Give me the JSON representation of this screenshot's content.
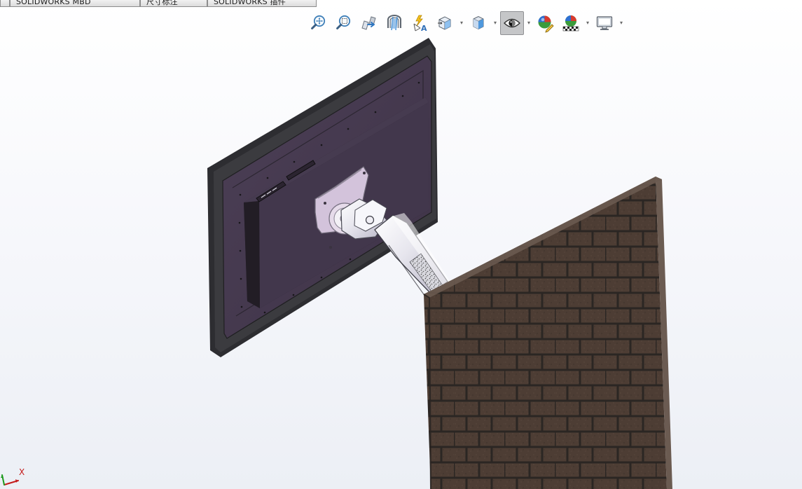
{
  "tabs": [
    {
      "label": ""
    },
    {
      "label": "SOLIDWORKS MBD"
    },
    {
      "label": "尺寸标注"
    },
    {
      "label": "SOLIDWORKS 插件"
    }
  ],
  "toolbar": {
    "items": [
      {
        "name": "zoom-to-fit",
        "icon": "zoom-fit-icon",
        "has_dropdown": false,
        "active": false
      },
      {
        "name": "zoom-to-area",
        "icon": "zoom-area-icon",
        "has_dropdown": false,
        "active": false
      },
      {
        "name": "previous-view",
        "icon": "previous-view-icon",
        "has_dropdown": false,
        "active": false
      },
      {
        "name": "section-view",
        "icon": "section-view-icon",
        "has_dropdown": false,
        "active": false
      },
      {
        "name": "dynamic-annotation-views",
        "icon": "dynamic-annotation-icon",
        "has_dropdown": false,
        "active": false
      },
      {
        "name": "view-orientation",
        "icon": "view-orientation-icon",
        "has_dropdown": true,
        "active": false
      },
      {
        "name": "display-style",
        "icon": "display-style-icon",
        "has_dropdown": true,
        "active": false
      },
      {
        "name": "hide-show-items",
        "icon": "eye-icon",
        "has_dropdown": true,
        "active": true
      },
      {
        "name": "edit-appearance",
        "icon": "edit-appearance-icon",
        "has_dropdown": false,
        "active": false
      },
      {
        "name": "apply-scene",
        "icon": "apply-scene-icon",
        "has_dropdown": true,
        "active": false
      },
      {
        "name": "view-settings",
        "icon": "monitor-icon",
        "has_dropdown": true,
        "active": false
      }
    ],
    "dropdown_glyph": "▾"
  },
  "triad": {
    "x_label": "X"
  },
  "colors": {
    "monitor_back": "#4a3d52",
    "monitor_bezel": "#3b3b3f",
    "brick": "#4d3d34",
    "mortar": "#2a2522",
    "arm_light": "#e9e8ee",
    "vesa_plate": "#d8c8e0"
  }
}
